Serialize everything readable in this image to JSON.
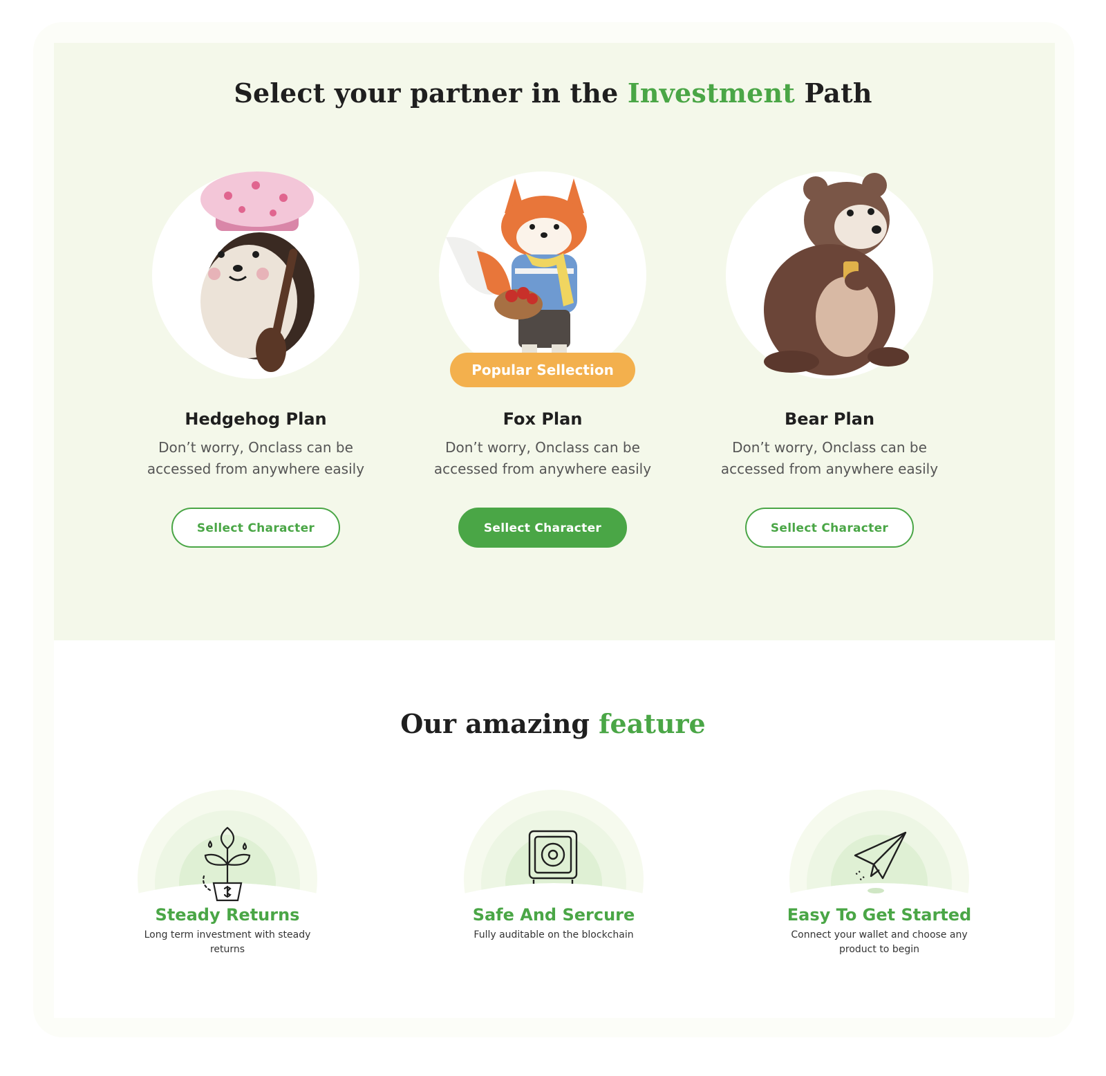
{
  "section1": {
    "title_prefix": "Select your partner in the ",
    "title_accent": "Investment",
    "title_suffix": " Path",
    "plans": [
      {
        "title": "Hedgehog Plan",
        "description": "Don’t worry, Onclass can be accessed from anywhere easily",
        "button": "Sellect Character",
        "icon": "hedgehog-illustration"
      },
      {
        "title": "Fox Plan",
        "description": "Don’t worry, Onclass can be accessed from anywhere easily",
        "button": "Sellect Character",
        "badge": "Popular Sellection",
        "icon": "fox-illustration"
      },
      {
        "title": "Bear Plan",
        "description": "Don’t worry, Onclass can be accessed from anywhere easily",
        "button": "Sellect Character",
        "icon": "bear-illustration"
      }
    ]
  },
  "section2": {
    "title_prefix": "Our amazing ",
    "title_accent": "feature",
    "features": [
      {
        "title": "Steady Returns",
        "description": "Long term investment with steady returns",
        "icon": "plant-pot-dollar-icon"
      },
      {
        "title": "Safe And Sercure",
        "description": "Fully auditable on the blockchain",
        "icon": "safe-vault-icon"
      },
      {
        "title": "Easy To Get Started",
        "description": "Connect your wallet and choose any product to begin",
        "icon": "paper-plane-icon"
      }
    ]
  },
  "colors": {
    "accent": "#4aa646",
    "badge": "#f3b04d",
    "panel": "#f4f8ea",
    "halo": "#e6f3dc"
  }
}
